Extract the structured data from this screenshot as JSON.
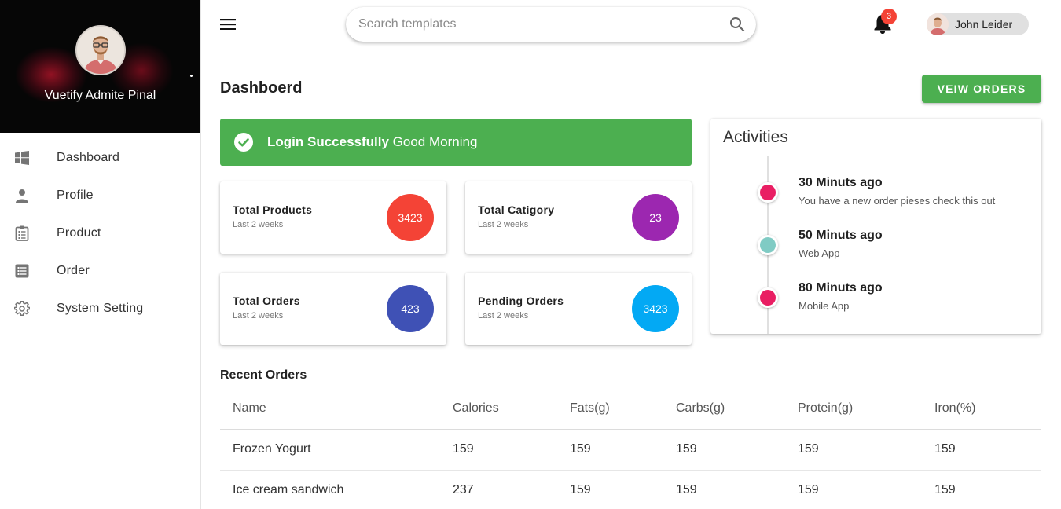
{
  "sidebar": {
    "admin_name": "Vuetify Admite Pinal",
    "items": [
      {
        "label": "Dashboard",
        "icon": "windows-icon"
      },
      {
        "label": "Profile",
        "icon": "person-icon"
      },
      {
        "label": "Product",
        "icon": "clipboard-list-icon"
      },
      {
        "label": "Order",
        "icon": "list-box-icon"
      },
      {
        "label": "System Setting",
        "icon": "gear-icon"
      }
    ]
  },
  "topbar": {
    "search_placeholder": "Search templates",
    "notification_count": "3",
    "user_name": "John Leider"
  },
  "page": {
    "title": "Dashboerd",
    "view_orders_label": "VEIW ORDERS"
  },
  "alert": {
    "bold": "Login Successfully",
    "text": "Good Morning"
  },
  "stats": [
    {
      "title": "Total Products",
      "subtitle": "Last 2 weeks",
      "value": "3423",
      "color": "#f44336"
    },
    {
      "title": "Total Catigory",
      "subtitle": "Last 2 weeks",
      "value": "23",
      "color": "#9c27b0"
    },
    {
      "title": "Total Orders",
      "subtitle": "Last 2 weeks",
      "value": "423",
      "color": "#3f51b5"
    },
    {
      "title": "Pending Orders",
      "subtitle": "Last 2 weeks",
      "value": "3423",
      "color": "#03a9f4"
    }
  ],
  "activities": {
    "title": "Activities",
    "items": [
      {
        "time": "30 Minuts ago",
        "desc": "You have a new order pieses check this out",
        "color": "#e91e63"
      },
      {
        "time": "50 Minuts ago",
        "desc": "Web App",
        "color": "#80cbc4"
      },
      {
        "time": "80 Minuts ago",
        "desc": "Mobile App",
        "color": "#e91e63"
      }
    ]
  },
  "recent_orders": {
    "title": "Recent Orders",
    "headers": [
      "Name",
      "Calories",
      "Fats(g)",
      "Carbs(g)",
      "Protein(g)",
      "Iron(%)"
    ],
    "rows": [
      [
        "Frozen Yogurt",
        "159",
        "159",
        "159",
        "159",
        "159"
      ],
      [
        "Ice cream sandwich",
        "237",
        "159",
        "159",
        "159",
        "159"
      ]
    ]
  }
}
